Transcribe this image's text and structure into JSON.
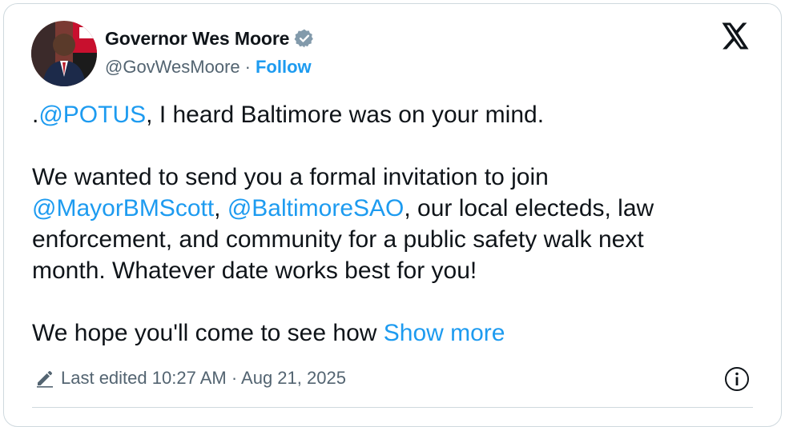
{
  "author": {
    "name": "Governor Wes Moore",
    "handle": "@GovWesMoore",
    "separator": "·",
    "follow_label": "Follow"
  },
  "tweet": {
    "line1_prefix": ".",
    "line1_mention": "@POTUS",
    "line1_rest": ", I heard Baltimore was on your mind.",
    "line2": "We wanted to send you a formal invitation to join",
    "line3_mention1": "@MayorBMScott",
    "line3_sep": ", ",
    "line3_mention2": "@BaltimoreSAO",
    "line3_rest": ", our local electeds, law",
    "line4": "enforcement, and community for a public safety walk next",
    "line5": "month. Whatever date works best for you!",
    "line6": "We hope you'll come to see how ",
    "show_more": "Show more"
  },
  "footer": {
    "edited_text": "Last edited 10:27 AM · Aug 21, 2025"
  },
  "icons": {
    "verified": "verified-badge-icon",
    "x": "x-logo-icon",
    "pencil": "pencil-icon",
    "info": "info-icon"
  },
  "colors": {
    "link": "#1d9bf0",
    "text": "#0f1419",
    "muted": "#536471",
    "border": "#cfd9de"
  }
}
